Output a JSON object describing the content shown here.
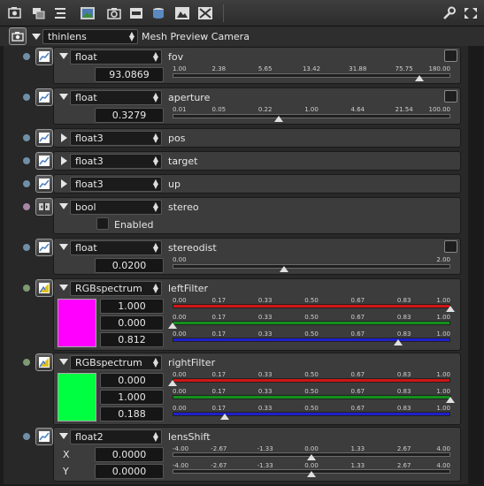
{
  "toolbar": {
    "icons": [
      "render-view-icon",
      "copy-layers-icon",
      "align-icon",
      "image-icon",
      "camera-icon",
      "film-icon",
      "stack-icon",
      "photo-icon",
      "texture-icon",
      "wrench-icon",
      "expand-icon"
    ]
  },
  "header": {
    "camera_type": "thinlens",
    "camera_name": "Mesh Preview Camera"
  },
  "params": {
    "fov": {
      "type": "float",
      "name": "fov",
      "value": "93.0869",
      "ticks": [
        "1.00",
        "2.38",
        "5.65",
        "13.42",
        "31.88",
        "75.75",
        "180.00"
      ],
      "position": 0.888
    },
    "aperture": {
      "type": "float",
      "name": "aperture",
      "value": "0.3279",
      "ticks": [
        "0.01",
        "0.05",
        "0.22",
        "1.00",
        "4.64",
        "21.54",
        "100.00"
      ],
      "position": 0.382
    },
    "pos": {
      "type": "float3",
      "name": "pos"
    },
    "target": {
      "type": "float3",
      "name": "target"
    },
    "up": {
      "type": "float3",
      "name": "up"
    },
    "stereo": {
      "type": "bool",
      "name": "stereo",
      "checkbox_label": "Enabled",
      "checked": false
    },
    "stereodist": {
      "type": "float",
      "name": "stereodist",
      "value": "0.0200",
      "ticks": [
        "0.00",
        "2.00"
      ],
      "position": 0.4
    },
    "leftFilter": {
      "type": "RGBspectrum",
      "name": "leftFilter",
      "color": "#ff00ff",
      "values": [
        "1.000",
        "0.000",
        "0.812"
      ],
      "ticks": [
        "0.00",
        "0.17",
        "0.33",
        "0.50",
        "0.67",
        "0.83",
        "1.00"
      ],
      "positions": [
        1.0,
        0.0,
        0.812
      ],
      "channel_colors": [
        "#d01515",
        "#14901c",
        "#2020c8"
      ]
    },
    "rightFilter": {
      "type": "RGBspectrum",
      "name": "rightFilter",
      "color": "#00ff40",
      "values": [
        "0.000",
        "1.000",
        "0.188"
      ],
      "ticks": [
        "0.00",
        "0.17",
        "0.33",
        "0.50",
        "0.67",
        "0.83",
        "1.00"
      ],
      "positions": [
        0.0,
        1.0,
        0.188
      ],
      "channel_colors": [
        "#d01515",
        "#14901c",
        "#2020c8"
      ]
    },
    "lensShift": {
      "type": "float2",
      "name": "lensShift",
      "axis_labels": [
        "X",
        "Y"
      ],
      "values": [
        "0.0000",
        "0.0000"
      ],
      "ticks": [
        "-4.00",
        "-2.67",
        "-1.33",
        "0.00",
        "1.33",
        "2.67",
        "4.00"
      ],
      "positions": [
        0.5,
        0.5
      ]
    }
  }
}
